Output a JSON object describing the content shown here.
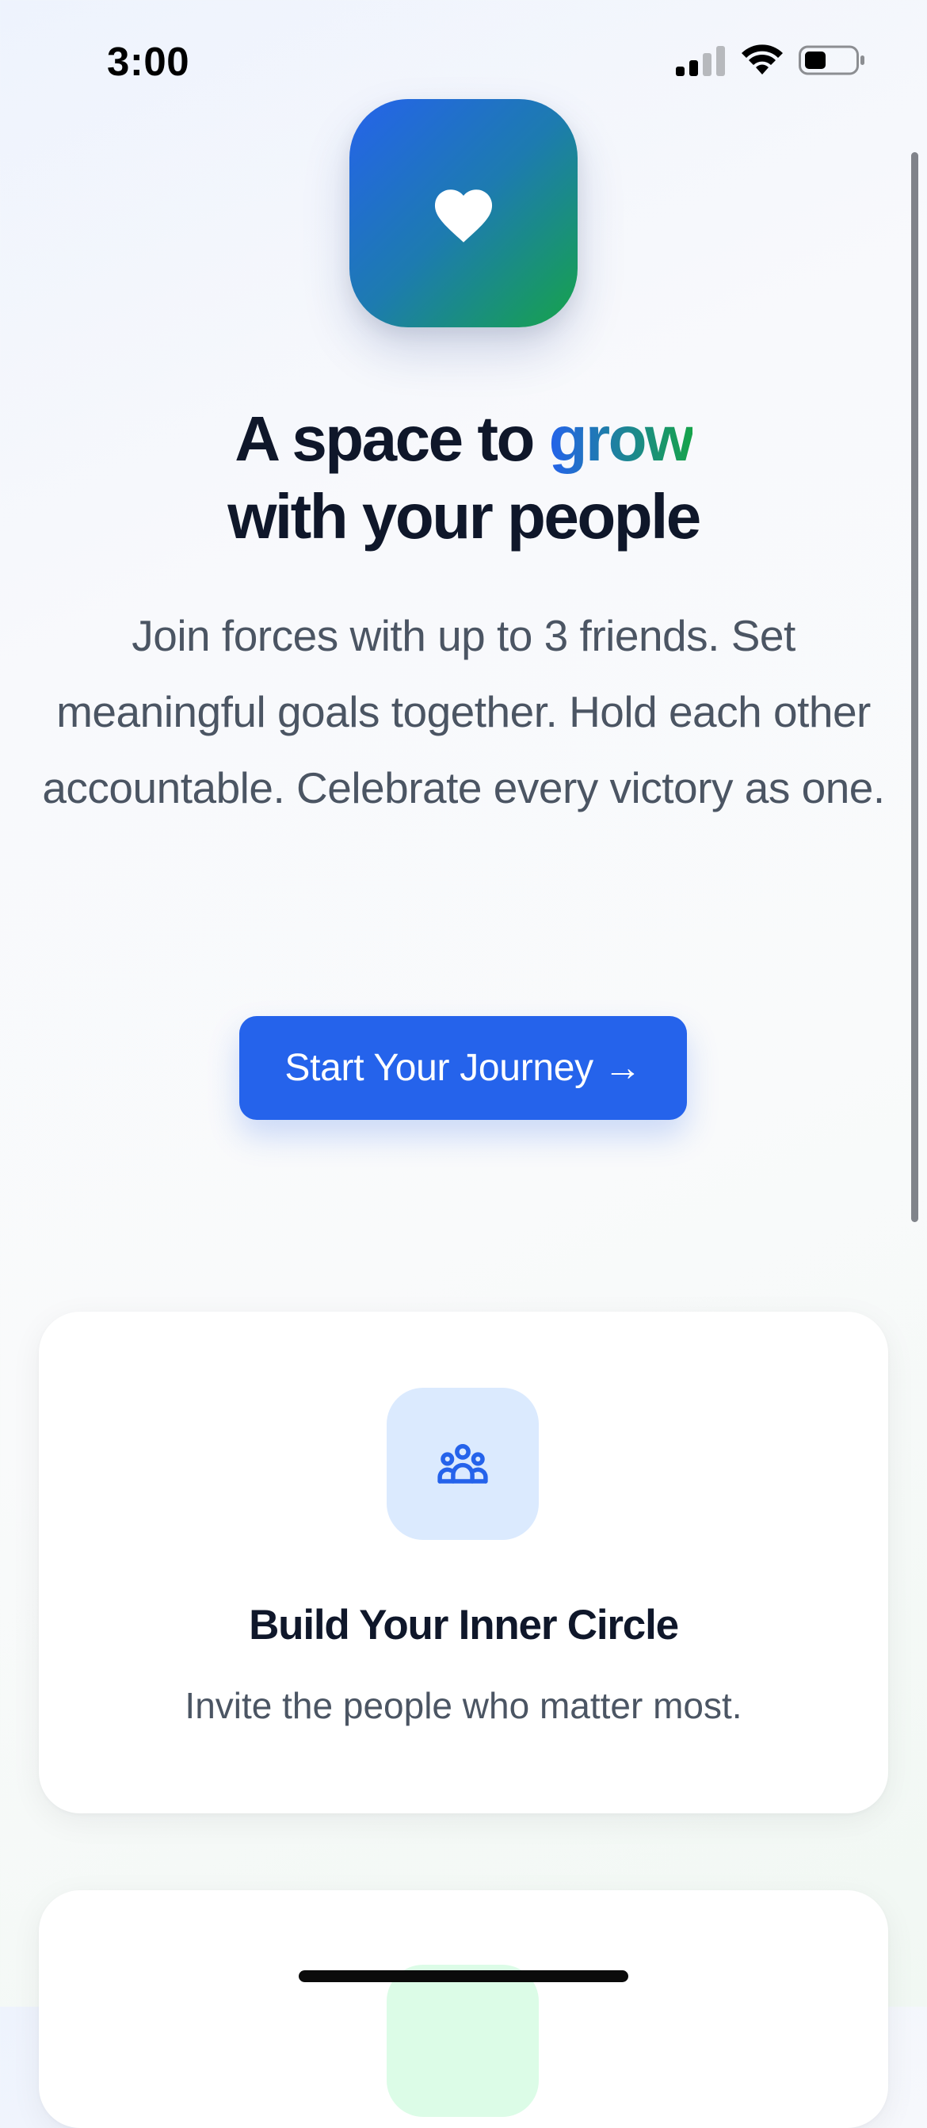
{
  "status_bar": {
    "time": "3:00",
    "icons": [
      "signal-icon",
      "wifi-icon",
      "battery-icon"
    ]
  },
  "app_icon": {
    "icon": "heart-icon",
    "gradient": [
      "#2563eb",
      "#16a34a"
    ]
  },
  "hero": {
    "headline_prefix": "A space to ",
    "headline_accent": "grow",
    "headline_suffix": "with your people",
    "subtitle": "Join forces with up to 3 friends. Set meaningful goals together. Hold each other accountable. Celebrate every victory as one.",
    "cta_label": "Start Your Journey →"
  },
  "features": [
    {
      "icon": "group-icon",
      "title": "Build Your Inner Circle",
      "description": "Invite the people who matter most."
    },
    {
      "icon": "feature-icon"
    }
  ],
  "colors": {
    "primary": "#2563eb",
    "accent_green": "#16a34a",
    "text_dark": "#0f172a",
    "text_muted": "#4b5563",
    "icon_bg_blue": "#dbeafe",
    "icon_bg_green": "#dcfce7"
  }
}
